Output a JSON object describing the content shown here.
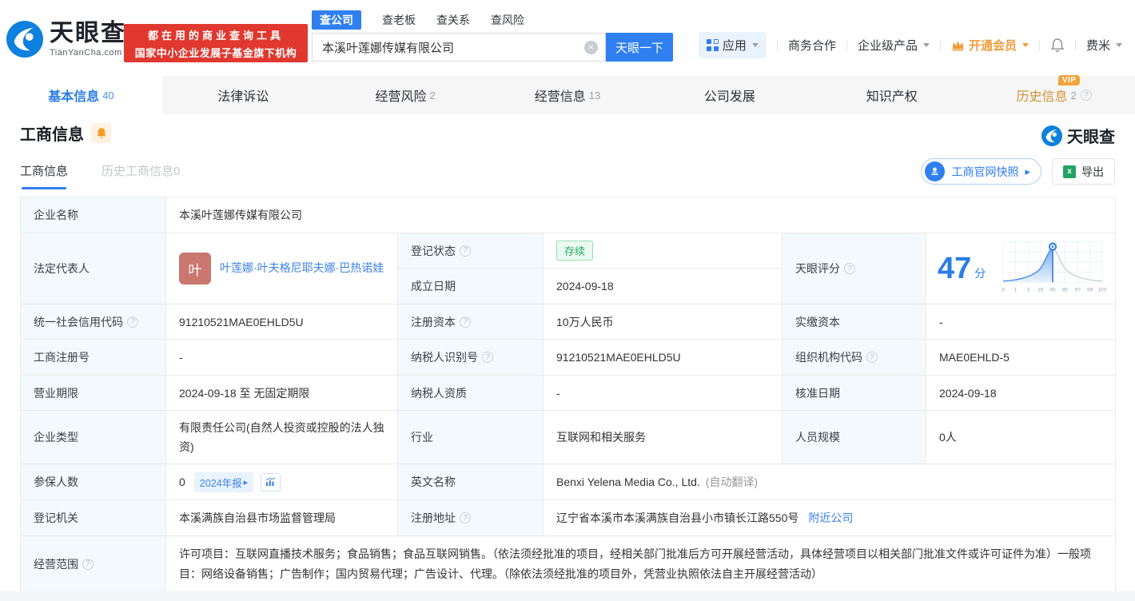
{
  "header": {
    "logo": {
      "brand": "天眼查",
      "domain": "TianYanCha.com"
    },
    "banner": {
      "line1": "都在用的商业查询工具",
      "line2": "国家中小企业发展子基金旗下机构"
    },
    "search": {
      "tabs": [
        {
          "label": "查公司",
          "active": true
        },
        {
          "label": "查老板",
          "active": false
        },
        {
          "label": "查关系",
          "active": false
        },
        {
          "label": "查风险",
          "active": false
        }
      ],
      "value": "本溪叶莲娜传媒有限公司",
      "button_label": "天眼一下"
    },
    "nav": {
      "apps_label": "应用",
      "business_label": "商务合作",
      "enterprise_label": "企业级产品",
      "vip_label": "开通会员",
      "user_label": "费米"
    }
  },
  "tabbar": {
    "vip_badge": "VIP",
    "tabs": [
      {
        "label": "基本信息",
        "count": "40",
        "active": true
      },
      {
        "label": "法律诉讼",
        "count": "",
        "active": false
      },
      {
        "label": "经营风险",
        "count": "2",
        "active": false
      },
      {
        "label": "经营信息",
        "count": "13",
        "active": false
      },
      {
        "label": "公司发展",
        "count": "",
        "active": false
      },
      {
        "label": "知识产权",
        "count": "",
        "active": false
      },
      {
        "label": "历史信息",
        "count": "2",
        "active": false,
        "vip": true
      }
    ]
  },
  "section": {
    "title": "工商信息",
    "subtabs": [
      {
        "label": "工商信息",
        "active": true
      },
      {
        "label": "历史工商信息0",
        "active": false
      }
    ],
    "brand": "天眼查",
    "snapshot_button": "工商官网快照",
    "export_button": "导出"
  },
  "table": {
    "company_name": {
      "label": "企业名称",
      "value": "本溪叶莲娜传媒有限公司"
    },
    "legal_rep": {
      "label": "法定代表人",
      "avatar_text": "叶",
      "name": "叶莲娜·叶夫格尼耶夫娜·巴热诺娃"
    },
    "reg_status": {
      "label": "登记状态",
      "value": "存续"
    },
    "establish_date": {
      "label": "成立日期",
      "value": "2024-09-18"
    },
    "score": {
      "label": "天眼评分",
      "value": "47",
      "unit": "分"
    },
    "credit_code": {
      "label": "统一社会信用代码",
      "value": "91210521MAE0EHLD5U"
    },
    "reg_capital": {
      "label": "注册资本",
      "value": "10万人民币"
    },
    "paid_capital": {
      "label": "实缴资本",
      "value": "-"
    },
    "reg_number": {
      "label": "工商注册号",
      "value": "-"
    },
    "taxpayer_id": {
      "label": "纳税人识别号",
      "value": "91210521MAE0EHLD5U"
    },
    "org_code": {
      "label": "组织机构代码",
      "value": "MAE0EHLD-5"
    },
    "business_term": {
      "label": "营业期限",
      "value": "2024-09-18 至 无固定期限"
    },
    "taxpayer_quality": {
      "label": "纳税人资质",
      "value": "-"
    },
    "approval_date": {
      "label": "核准日期",
      "value": "2024-09-18"
    },
    "company_type": {
      "label": "企业类型",
      "value": "有限责任公司(自然人投资或控股的法人独资)"
    },
    "industry": {
      "label": "行业",
      "value": "互联网和相关服务"
    },
    "staff_size": {
      "label": "人员规模",
      "value": "0人"
    },
    "insured_count": {
      "label": "参保人数",
      "value": "0",
      "report_badge": "2024年报"
    },
    "english_name": {
      "label": "英文名称",
      "value": "Benxi Yelena Media Co., Ltd.",
      "note": "(自动翻译)"
    },
    "reg_authority": {
      "label": "登记机关",
      "value": "本溪满族自治县市场监督管理局"
    },
    "reg_address": {
      "label": "注册地址",
      "value": "辽宁省本溪市本溪满族自治县小市镇长江路550号",
      "link": "附近公司"
    },
    "business_scope": {
      "label": "经营范围",
      "value": "许可项目：互联网直播技术服务；食品销售；食品互联网销售。（依法须经批准的项目，经相关部门批准后方可开展经营活动，具体经营项目以相关部门批准文件或许可证件为准）一般项目：网络设备销售；广告制作；国内贸易代理；广告设计、代理。（除依法须经批准的项目外，凭营业执照依法自主开展经营活动）"
    }
  },
  "chart_data": {
    "type": "area",
    "title": "天眼评分分布曲线",
    "score": 47,
    "score_unit": "分",
    "x_tick_labels": [
      "0",
      "1",
      "3",
      "15",
      "50",
      "85",
      "97",
      "99",
      "100"
    ],
    "curve_y_normalized": [
      0.03,
      0.06,
      0.14,
      0.42,
      1.0,
      0.42,
      0.14,
      0.06,
      0.03
    ],
    "marker_tick": "50",
    "filled_region": "left-of-marker",
    "grid": true
  },
  "icons": {
    "logo": "tianyancha-swirl-eye",
    "clear": "circle-x",
    "apps": "grid-squares",
    "vip": "crown",
    "notification": "bell-outline",
    "section_bell": "bell-solid-orange",
    "snapshot": "stamp",
    "export": "excel",
    "insured_trend": "mini-bar-chart",
    "help": "question-circle",
    "caret": "chevron-down"
  },
  "colors": {
    "brand_blue": "#2f7ff0",
    "banner_red": "#e0382e",
    "vip_orange": "#f29b38",
    "history_tab_orange": "#cf8f35",
    "status_green": "#2aa866",
    "score_blue": "#2a7ce8",
    "label_cell_bg": "#f3f9fd",
    "avatar_red": "#c9776f"
  }
}
